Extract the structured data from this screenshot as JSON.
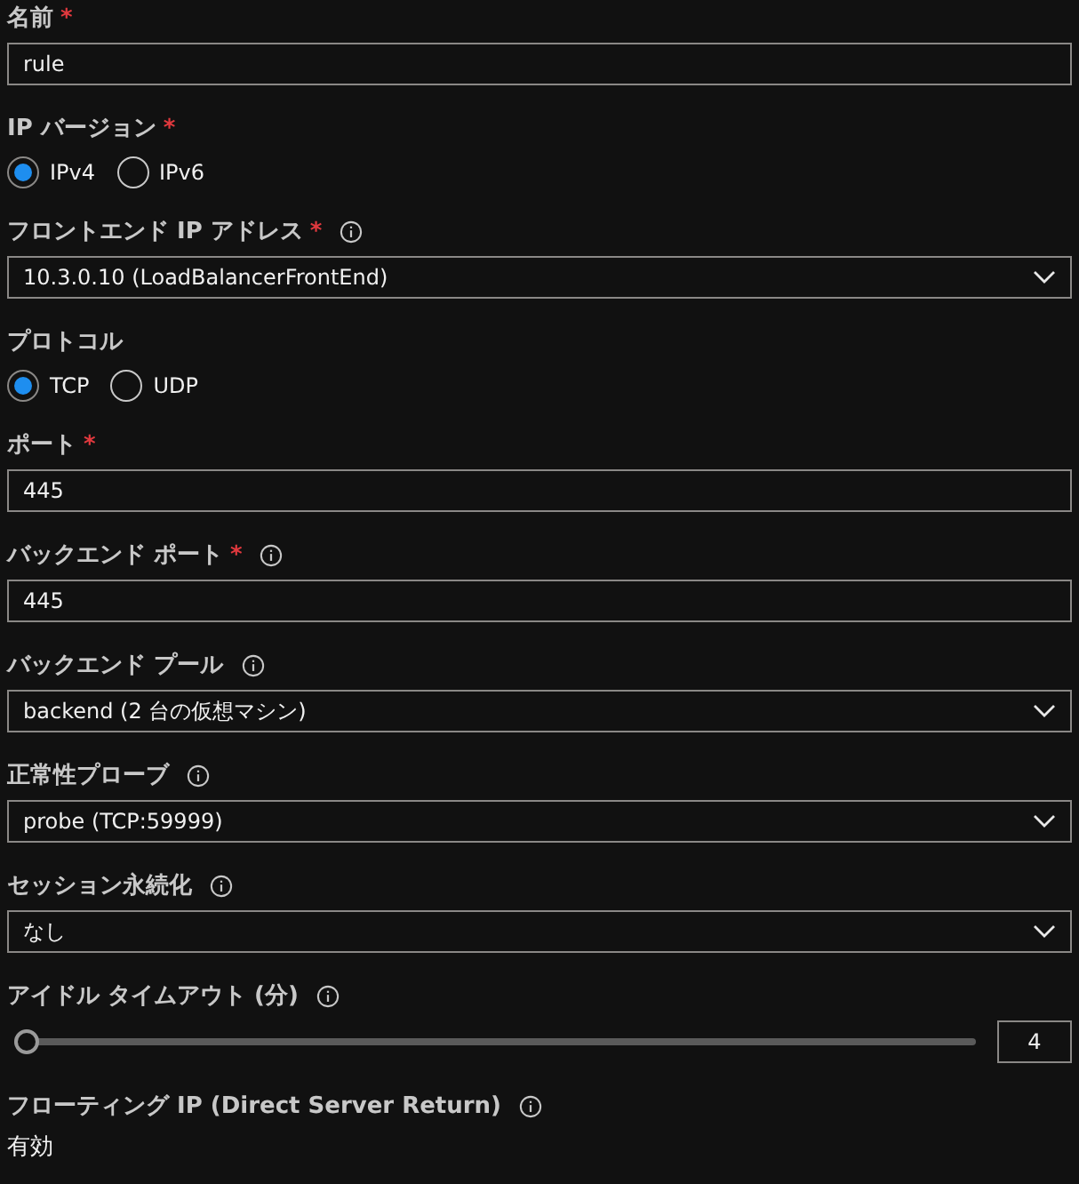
{
  "fields": [
    {
      "kind": "text",
      "label": "名前",
      "required_mark": "*",
      "info": false,
      "value": "rule"
    },
    {
      "kind": "radio",
      "label": "IP バージョン",
      "required_mark": "*",
      "info": false,
      "options": [
        {
          "label": "IPv4",
          "selected": true
        },
        {
          "label": "IPv6",
          "selected": false
        }
      ]
    },
    {
      "kind": "select",
      "label": "フロントエンド IP アドレス",
      "required_mark": "*",
      "info": true,
      "value": "10.3.0.10 (LoadBalancerFrontEnd)"
    },
    {
      "kind": "radio",
      "label": "プロトコル",
      "info": false,
      "options": [
        {
          "label": "TCP",
          "selected": true
        },
        {
          "label": "UDP",
          "selected": false
        }
      ]
    },
    {
      "kind": "text",
      "label": "ポート",
      "required_mark": "*",
      "info": false,
      "value": "445"
    },
    {
      "kind": "text",
      "label": "バックエンド ポート",
      "required_mark": "*",
      "info": true,
      "value": "445"
    },
    {
      "kind": "select",
      "label": "バックエンド プール",
      "info": true,
      "value": "backend (2 台の仮想マシン)"
    },
    {
      "kind": "select",
      "label": "正常性プローブ",
      "info": true,
      "value": "probe (TCP:59999)"
    },
    {
      "kind": "select",
      "label": "セッション永続化",
      "info": true,
      "value": "なし"
    },
    {
      "kind": "slider",
      "label": "アイドル タイムアウト (分)",
      "info": true,
      "level": 0,
      "value": "4"
    },
    {
      "kind": "static",
      "label": "フローティング IP (Direct Server Return)",
      "info": true,
      "value": "有効"
    }
  ]
}
